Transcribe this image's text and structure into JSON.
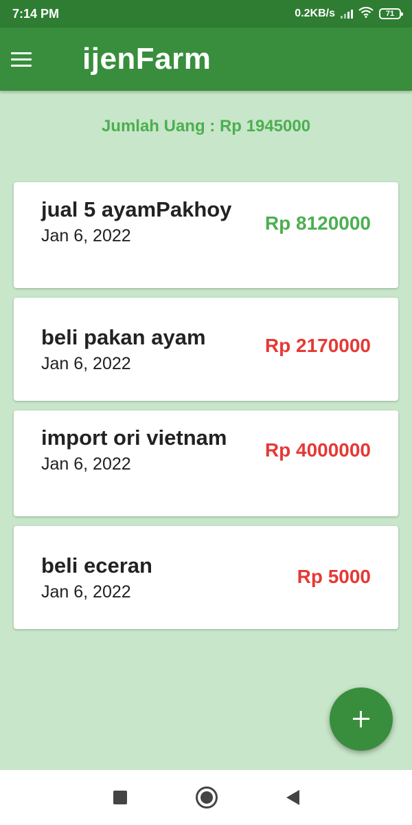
{
  "status_bar": {
    "time": "7:14 PM",
    "net_speed": "0.2KB/s",
    "battery": "71"
  },
  "app_bar": {
    "title": "ijenFarm",
    "menu_icon": "hamburger-menu-icon"
  },
  "summary": {
    "total_text": "Jumlah Uang : Rp 1945000"
  },
  "transactions": [
    {
      "title": "jual 5 ayamPakhoy",
      "date": "Jan 6, 2022",
      "amount": "Rp 8120000",
      "type": "income"
    },
    {
      "title": "beli pakan ayam",
      "date": "Jan 6, 2022",
      "amount": "Rp 2170000",
      "type": "expense"
    },
    {
      "title": "import ori vietnam",
      "date": "Jan 6, 2022",
      "amount": "Rp 4000000",
      "type": "expense"
    },
    {
      "title": "beli eceran",
      "date": "Jan 6, 2022",
      "amount": "Rp 5000",
      "type": "expense"
    }
  ],
  "fab": {
    "icon": "plus-icon"
  },
  "colors": {
    "primary": "#388e3c",
    "primary_dark": "#2e7d32",
    "background": "#c8e6c9",
    "income": "#4caf50",
    "expense": "#e53935"
  }
}
